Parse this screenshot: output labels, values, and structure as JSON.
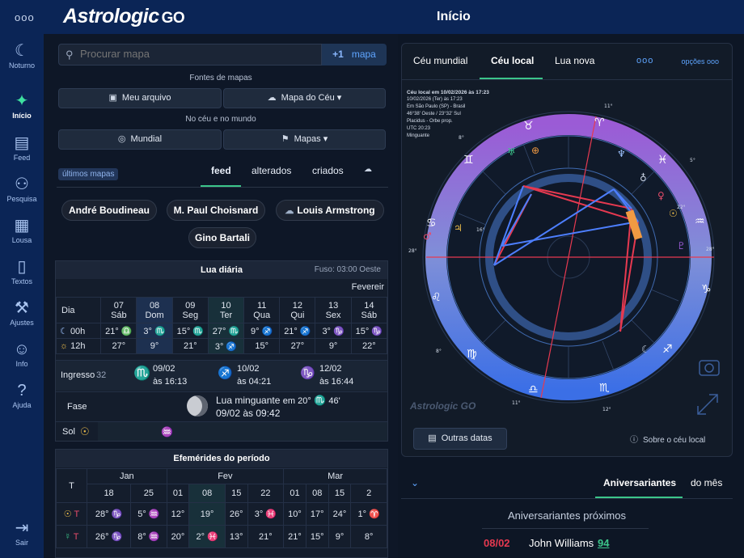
{
  "app": {
    "logo": "Astrologic",
    "logo_go": "GO",
    "page_title": "Início",
    "menu_dots": "ooo"
  },
  "sidebar": [
    {
      "label": "Noturno",
      "icon": "moon-star-icon",
      "glyph": "☾"
    },
    {
      "label": "Início",
      "icon": "sparkle-icon",
      "glyph": "✦"
    },
    {
      "label": "Feed",
      "icon": "feed-icon",
      "glyph": "▤"
    },
    {
      "label": "Pesquisa",
      "icon": "people-icon",
      "glyph": "⚇"
    },
    {
      "label": "Lousa",
      "icon": "board-icon",
      "glyph": "▦"
    },
    {
      "label": "Textos",
      "icon": "document-icon",
      "glyph": "▯"
    },
    {
      "label": "Ajustes",
      "icon": "tools-icon",
      "glyph": "⚒"
    },
    {
      "label": "Info",
      "icon": "info-person-icon",
      "glyph": "☺"
    },
    {
      "label": "Ajuda",
      "icon": "help-icon",
      "glyph": "?"
    },
    {
      "label": "Sair",
      "icon": "exit-icon",
      "glyph": "⇥"
    }
  ],
  "search": {
    "placeholder": "Procurar mapa",
    "add_plus": "+1",
    "add_label": "mapa"
  },
  "sources": {
    "title": "Fontes de mapas",
    "my_file": "Meu arquivo",
    "sky_map": "Mapa do Céu",
    "subtitle": "No céu e no mundo",
    "world": "Mundial",
    "maps": "Mapas"
  },
  "feed_tabs": {
    "recent": "últimos mapas",
    "feed": "feed",
    "altered": "alterados",
    "created": "criados"
  },
  "chips": [
    "André Boudineau",
    "M. Paul Choisnard",
    "Louis Armstrong",
    "Gino Bartali"
  ],
  "lua_diaria": {
    "title": "Lua diária",
    "fuso": "Fuso: 03:00 Oeste",
    "month": "Fevereir",
    "dia_label": "Dia",
    "days": [
      {
        "n": "07",
        "d": "Sáb"
      },
      {
        "n": "08",
        "d": "Dom"
      },
      {
        "n": "09",
        "d": "Seg"
      },
      {
        "n": "10",
        "d": "Ter"
      },
      {
        "n": "11",
        "d": "Qua"
      },
      {
        "n": "12",
        "d": "Qui"
      },
      {
        "n": "13",
        "d": "Sex"
      },
      {
        "n": "14",
        "d": "Sáb"
      }
    ],
    "row00_label": "00h",
    "row12_label": "12h",
    "row00": [
      "21° ♎",
      "3° ♏",
      "15° ♏",
      "27° ♏",
      "9° ♐",
      "21° ♐",
      "3° ♑",
      "15° ♑"
    ],
    "row12": [
      "27°",
      "9°",
      "21°",
      "3° ♐",
      "15°",
      "27°",
      "9°",
      "22°"
    ],
    "ingresso_label": "Ingresso",
    "ingressos": [
      {
        "sign": "♏",
        "date": "09/02",
        "time": "às 16:13"
      },
      {
        "sign": "♐",
        "date": "10/02",
        "time": "às 04:21"
      },
      {
        "sign": "♑",
        "date": "12/02",
        "time": "às 16:44"
      }
    ],
    "ingresso_lead": "32",
    "fase_label": "Fase",
    "fase_text": "Lua minguante",
    "fase_em": "em 20°",
    "fase_minutes": "46'",
    "fase_date": "09/02 às 09:42",
    "sol_label": "Sol"
  },
  "efemerides": {
    "title": "Efemérides do período",
    "months": [
      "Jan",
      "Fev",
      "Mar"
    ],
    "t_label": "T",
    "days": [
      "18",
      "25",
      "01",
      "08",
      "15",
      "22",
      "01",
      "08",
      "15",
      "2"
    ],
    "sun_row": [
      "28° ♑",
      "5° ♒",
      "12°",
      "19°",
      "26°",
      "3° ♓",
      "10°",
      "17°",
      "24°",
      "1° ♈"
    ],
    "mercury_row": [
      "26° ♑",
      "8° ♒",
      "20°",
      "2° ♓",
      "13°",
      "21°",
      "21°",
      "15°",
      "9°",
      "8°"
    ]
  },
  "right": {
    "tabs": [
      "Céu mundial",
      "Céu local",
      "Lua nova"
    ],
    "options": "opções",
    "info": [
      "Céu local em 10/02/2026 às 17:23",
      "10/02/2026 (Ter) às 17:23",
      "Em São Paulo (SP) - Brasil",
      "46°38' Oeste / 23°32' Sul",
      "Placidus - Orbe prop.",
      "UTC 20:23",
      "Minguante"
    ],
    "watermark": "Astrologic GO",
    "outras": "Outras datas",
    "sobre": "Sobre o céu local",
    "aniv_tab1": "Aniversariantes",
    "aniv_tab2": "do mês",
    "aniv_title": "Aniversariantes próximos",
    "aniv_date": "08/02",
    "aniv_name": "John Williams",
    "aniv_age": "94"
  },
  "colors": {
    "accent_green": "#3cc58a",
    "link_blue": "#5fa5ff",
    "red_aspect": "#e63950",
    "blue_aspect": "#4d7fff"
  }
}
